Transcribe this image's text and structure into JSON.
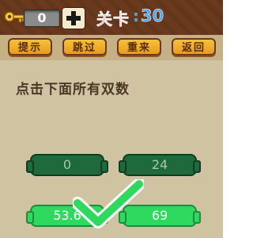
{
  "header": {
    "key_count": "0",
    "level_label": "关卡",
    "level_colon": ":",
    "level_number": "30"
  },
  "menu": {
    "hint": "提示",
    "skip": "跳过",
    "restart": "重来",
    "back": "返回"
  },
  "main": {
    "instruction": "点击下面所有双数",
    "tiles": [
      "0",
      "24",
      "53.6",
      "69"
    ]
  },
  "colors": {
    "topbar": "#6b3a1e",
    "menu_button": "#f6c13b",
    "tile_dark": "#1f6a3c",
    "tile_bright": "#2fd95e",
    "level_red": "#e8231c",
    "level_blue": "#4fa7e8",
    "checkmark": "#2fd95e"
  },
  "icons": {
    "key": "key-icon",
    "plus": "plus-icon",
    "check": "checkmark-icon"
  }
}
